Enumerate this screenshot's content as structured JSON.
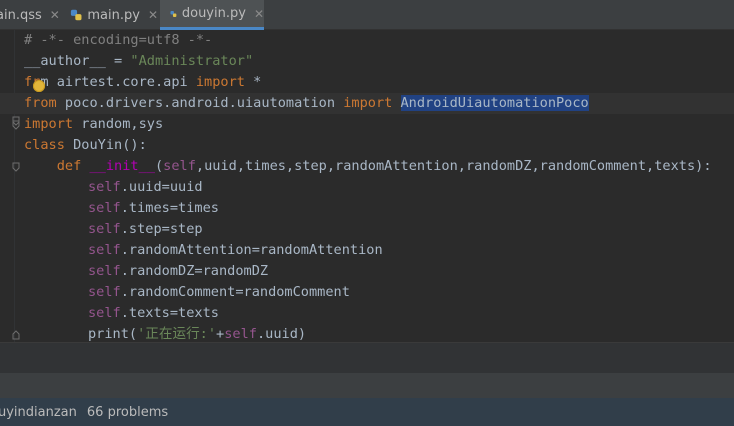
{
  "tabs": [
    {
      "label": "ain.qss",
      "close": "✕"
    },
    {
      "label": "main.py",
      "close": "✕"
    },
    {
      "label": "douyin.py",
      "close": "✕"
    }
  ],
  "code": {
    "l1": "# -*- encoding=utf8 -*-",
    "l2_a": "__author__ = ",
    "l2_b": "\"Administrator\"",
    "l3_a": "fr",
    "l3_b": "m airtest.core.api ",
    "l3_c": "import",
    "l3_d": " *",
    "l4_a": "from",
    "l4_b": " poco.drivers.android.uiautomation ",
    "l4_c": "import",
    "l4_d": " ",
    "l4_e": "AndroidUiautomationPoco",
    "l5_a": "import",
    "l5_b": " random,sys",
    "l6_a": "class",
    "l6_b": " DouYin():",
    "l7_a": "    def ",
    "l7_b": "__init__",
    "l7_c": "(",
    "l7_d": "self",
    "l7_e": ",uuid,times,step,randomAttention,randomDZ,randomComment,texts):",
    "self": "self",
    "l8": ".uuid=uuid",
    "l9": ".times=times",
    "l10": ".step=step",
    "l11": ".randomAttention=randomAttention",
    "l12": ".randomDZ=randomDZ",
    "l13": ".randomComment=randomComment",
    "l14": ".texts=texts",
    "l15_a": "print(",
    "l15_b": "'正在运行:'",
    "l15_c": "+",
    "l15_d": "self",
    "l15_e": ".uuid)"
  },
  "status": {
    "context": "uyindianzan",
    "problems": "66 problems"
  },
  "icons": [
    "python-file-icon",
    "close-icon",
    "lightbulb-icon",
    "fold-marker-icon"
  ],
  "colors": {
    "keyword": "#cc7832",
    "string": "#6a8759",
    "self": "#94558d",
    "dunder": "#b200b2",
    "comment": "#808080",
    "selection": "#214283"
  }
}
